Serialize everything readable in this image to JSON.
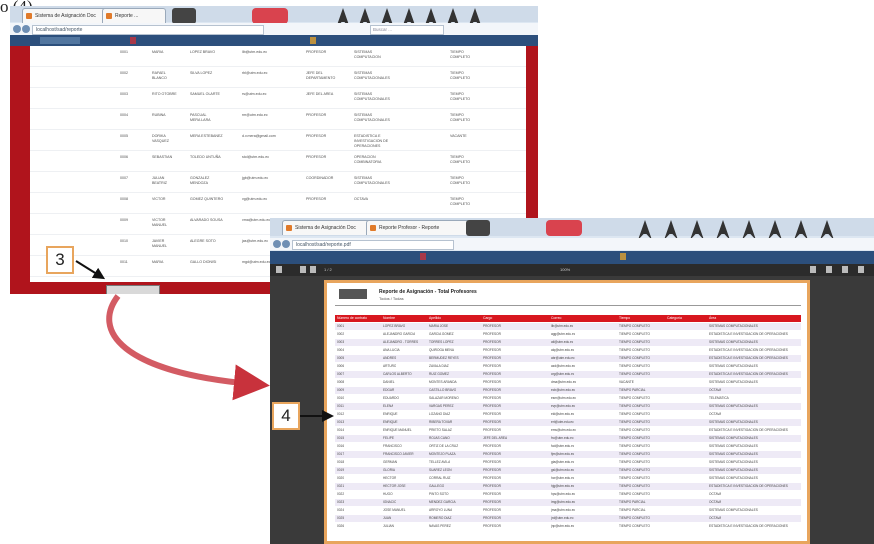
{
  "caption_fragment": "o (4).",
  "window1": {
    "tabs": [
      "Sistema de Asignación Doc",
      "Reporte ..."
    ],
    "address": "localhost/sad/reporte",
    "search_placeholder": "Buscar ...",
    "rows": [
      {
        "c1": "0001",
        "c2": "MARIA",
        "c3": "LOPEZ BRAVO",
        "c4": "llb@utm.edu.ec",
        "c5": "PROFESOR",
        "c6": "SISTEMAS\nCOMPUTACION",
        "c7": "TIEMPO\nCOMPLETO"
      },
      {
        "c1": "0002",
        "c2": "RAFAEL\nBLANCO",
        "c3": "SILVA LOPEZ",
        "c4": "rbl@utm.edu.ec",
        "c5": "JEFE DEL\nDEPARTAMENTO",
        "c6": "SISTEMAS\nCOMPUTACIONALES",
        "c7": "TIEMPO\nCOMPLETO"
      },
      {
        "c1": "0003",
        "c2": "RITO OTOBRE",
        "c3": "SAMUEL OLARTE",
        "c4": "rs@utm.edu.ec",
        "c5": "JEFE DEL AREA",
        "c6": "SISTEMAS\nCOMPUTACIONALES",
        "c7": "TIEMPO\nCOMPLETO"
      },
      {
        "c1": "0004",
        "c2": "RUBINA",
        "c3": "PASCUAL\nMERA LARA",
        "c4": "rm@utm.edu.ec",
        "c5": "PROFESOR",
        "c6": "SISTEMAS\nCOMPUTACIONALES",
        "c7": "TIEMPO\nCOMPLETO"
      },
      {
        "c1": "0005",
        "c2": "DORIKA\nVASQUEZ",
        "c3": "MERA ESTEBANEZ",
        "c4": "d.v.mera@gmail.com",
        "c5": "PROFESOR",
        "c6": "ESTADISTICA E\nINVESTIGACION DE\nOPERACIONES",
        "c7": "VACANTE"
      },
      {
        "c1": "0006",
        "c2": "SEBASTIAN",
        "c3": "TOLEDO UNTUÑA",
        "c4": "stol@utm.edu.ec",
        "c5": "PROFESOR",
        "c6": "OPERACION\nCOMBINATORIA",
        "c7": "TIEMPO\nCOMPLETO"
      },
      {
        "c1": "0007",
        "c2": "JULIAN\nBEATRIZ",
        "c3": "GONZALEZ\nMENDOZA",
        "c4": "jgb@utm.edu.ec",
        "c5": "COORDINADOR",
        "c6": "SISTEMAS\nCOMPUTACIONALES",
        "c7": "TIEMPO\nCOMPLETO"
      },
      {
        "c1": "0008",
        "c2": "VICTOR",
        "c3": "GOMEZ QUINTERO",
        "c4": "vg@utm.edu.ec",
        "c5": "PROFESOR",
        "c6": "OCTAVA",
        "c7": "TIEMPO\nCOMPLETO"
      },
      {
        "c1": "0009",
        "c2": "VICTOR\nMANUEL",
        "c3": "ALVARADO SOUSA",
        "c4": "vma@utm.edu.ec",
        "c5": "PROFESOR",
        "c6": "ESTADISTICA E\nINVESTIGACION",
        "c7": "TIEMPO\nCOMPLETO"
      },
      {
        "c1": "0010",
        "c2": "JAVIER\nMANUEL",
        "c3": "ALEGRE SOTO",
        "c4": "jas@utm.edu.ec",
        "c5": "PROFESOR",
        "c6": "",
        "c7": ""
      },
      {
        "c1": "0011",
        "c2": "MARIA",
        "c3": "GALLO DIONISI",
        "c4": "mgd@utm.edu.ec",
        "c5": "",
        "c6": "",
        "c7": ""
      }
    ]
  },
  "window2": {
    "tabs": [
      "Sistema de Asignación Doc",
      "Reporte Profesor - Reporte"
    ],
    "address": "localhost/sad/reporte.pdf",
    "pdf_toolbar": {
      "pages": "1 / 2",
      "zoom": "100%"
    },
    "doc_title": "Reporte de Asignación - Total Profesores",
    "doc_subtitle": "Todos / Todas",
    "headers": [
      "Número de contrato",
      "Nombre",
      "Apellido",
      "Cargo",
      "Correo",
      "Tiempo",
      "Categoría",
      "Área"
    ],
    "rows": [
      [
        "0001",
        "LOPEZ BRAVO",
        "MARIA JOSE",
        "PROFESOR",
        "llb@utm.edu.ec",
        "TIEMPO COMPLETO",
        "",
        "SISTEMAS COMPUTACIONALES"
      ],
      [
        "0002",
        "ALEJANDRO GARCIA",
        "GARCIA GOMEZ",
        "PROFESOR",
        "agg@utm.edu.ec",
        "TIEMPO COMPLETO",
        "",
        "ESTADISTICA E INVESTIGACION DE OPERACIONES"
      ],
      [
        "0003",
        "ALEJANDRO - TORRES",
        "TORRES LOPEZ",
        "PROFESOR",
        "atl@utm.edu.ec",
        "TIEMPO COMPLETO",
        "",
        "SISTEMAS COMPUTACIONALES"
      ],
      [
        "0004",
        "ANA LUCIA",
        "QUIROGA MENA",
        "PROFESOR",
        "alq@utm.edu.ec",
        "TIEMPO COMPLETO",
        "",
        "ESTADISTICA E INVESTIGACION DE OPERACIONES"
      ],
      [
        "0005",
        "ANDRES",
        "BERMUDEZ REYES",
        "PROFESOR",
        "abr@utm.edu.ec",
        "TIEMPO COMPLETO",
        "",
        "ESTADISTICA E INVESTIGACION DE OPERACIONES"
      ],
      [
        "0006",
        "ARTURO",
        "ZAVALA DIAZ",
        "PROFESOR",
        "azd@utm.edu.ec",
        "TIEMPO COMPLETO",
        "",
        "SISTEMAS COMPUTACIONALES"
      ],
      [
        "0007",
        "CARLOS ALBERTO",
        "RUIZ GOMEZ",
        "PROFESOR",
        "crg@utm.edu.ec",
        "TIEMPO COMPLETO",
        "",
        "ESTADISTICA E INVESTIGACION DE OPERACIONES"
      ],
      [
        "0008",
        "DANIEL",
        "MONTES ARANDA",
        "PROFESOR",
        "dma@utm.edu.ec",
        "VACANTE",
        "",
        "SISTEMAS COMPUTACIONALES"
      ],
      [
        "0009",
        "EDGAR",
        "CASTILLO BRAVO",
        "PROFESOR",
        "ecb@utm.edu.ec",
        "TIEMPO PARCIAL",
        "",
        "OCTAVA"
      ],
      [
        "0010",
        "EDUARDO",
        "SALAZAR MORENO",
        "PROFESOR",
        "esm@utm.edu.ec",
        "TIEMPO COMPLETO",
        "",
        "TELEMATICA"
      ],
      [
        "0011",
        "ELENA",
        "VARGAS PEREZ",
        "PROFESOR",
        "evp@utm.edu.ec",
        "TIEMPO COMPLETO",
        "",
        "SISTEMAS COMPUTACIONALES"
      ],
      [
        "0012",
        "ENRIQUE",
        "LOZANO DIAZ",
        "PROFESOR",
        "eld@utm.edu.ec",
        "TIEMPO COMPLETO",
        "",
        "OCTAVA"
      ],
      [
        "0013",
        "ENRIQUE",
        "RIBERA TOVAR",
        "PROFESOR",
        "ert@utm.edu.ec",
        "TIEMPO COMPLETO",
        "",
        "SISTEMAS COMPUTACIONALES"
      ],
      [
        "0014",
        "ENRIQUE MANUEL",
        "PRIETO SALAZ",
        "PROFESOR",
        "ems@utm.edu.ec",
        "TIEMPO COMPLETO",
        "",
        "ESTADISTICA E INVESTIGACION DE OPERACIONES"
      ],
      [
        "0015",
        "FELIPE",
        "ROJAS CANO",
        "JEFE DEL AREA",
        "frc@utm.edu.ec",
        "TIEMPO COMPLETO",
        "",
        "SISTEMAS COMPUTACIONALES"
      ],
      [
        "0016",
        "FRANCISCO",
        "ORTIZ DE LA CRUZ",
        "PROFESOR",
        "fod@utm.edu.ec",
        "TIEMPO COMPLETO",
        "",
        "SISTEMAS COMPUTACIONALES"
      ],
      [
        "0017",
        "FRANCISCO JAVIER",
        "MONTEJO PLAZA",
        "PROFESOR",
        "fjm@utm.edu.ec",
        "TIEMPO COMPLETO",
        "",
        "SISTEMAS COMPUTACIONALES"
      ],
      [
        "0018",
        "GERMAN",
        "TELLEZ AVILA",
        "PROFESOR",
        "gta@utm.edu.ec",
        "TIEMPO COMPLETO",
        "",
        "SISTEMAS COMPUTACIONALES"
      ],
      [
        "0019",
        "GLORIA",
        "SUAREZ LEON",
        "PROFESOR",
        "gsl@utm.edu.ec",
        "TIEMPO COMPLETO",
        "",
        "SISTEMAS COMPUTACIONALES"
      ],
      [
        "0020",
        "HECTOR",
        "CORRAL RUIZ",
        "PROFESOR",
        "hcr@utm.edu.ec",
        "TIEMPO COMPLETO",
        "",
        "SISTEMAS COMPUTACIONALES"
      ],
      [
        "0021",
        "HECTOR JOSE",
        "GALLEGO",
        "PROFESOR",
        "hjg@utm.edu.ec",
        "TIEMPO COMPLETO",
        "",
        "ESTADISTICA E INVESTIGACION DE OPERACIONES"
      ],
      [
        "0022",
        "HUGO",
        "PINTO SOTO",
        "PROFESOR",
        "hps@utm.edu.ec",
        "TIEMPO COMPLETO",
        "",
        "OCTAVA"
      ],
      [
        "0023",
        "IGNACIO",
        "MENDEZ GARCIA",
        "PROFESOR",
        "img@utm.edu.ec",
        "TIEMPO PARCIAL",
        "",
        "OCTAVA"
      ],
      [
        "0024",
        "JOSE MANUEL",
        "ARROYO LUNA",
        "PROFESOR",
        "jma@utm.edu.ec",
        "TIEMPO PARCIAL",
        "",
        "SISTEMAS COMPUTACIONALES"
      ],
      [
        "0025",
        "JUAN",
        "ROMERO DIAZ",
        "PROFESOR",
        "jrd@utm.edu.ec",
        "TIEMPO COMPLETO",
        "",
        "OCTAVA"
      ],
      [
        "0026",
        "JULIAN",
        "NAVAS PEREZ",
        "PROFESOR",
        "jnp@utm.edu.ec",
        "TIEMPO COMPLETO",
        "",
        "ESTADISTICA E INVESTIGACION DE OPERACIONES"
      ]
    ]
  },
  "callouts": {
    "step3": "3",
    "step4": "4"
  },
  "colors": {
    "accent_red": "#d8171f",
    "callout_border": "#e8a55d",
    "arrow": "#c8323c"
  }
}
